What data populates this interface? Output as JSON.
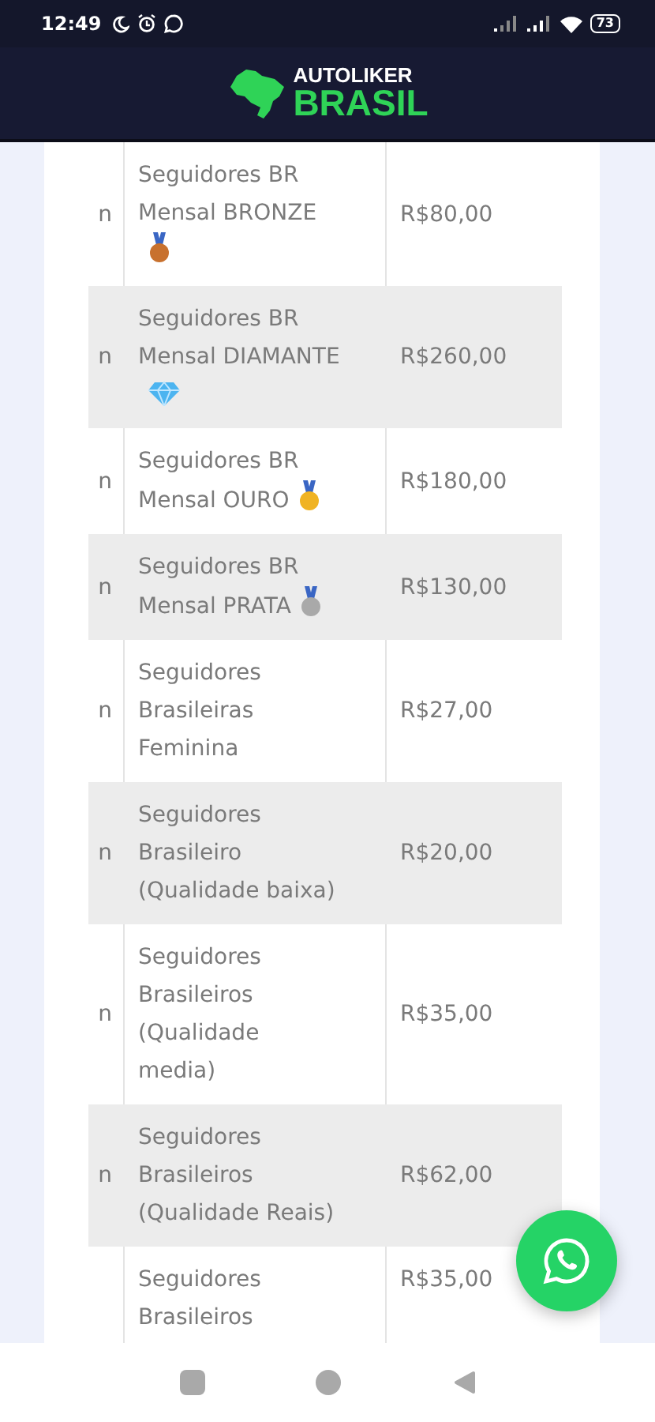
{
  "status_bar": {
    "time": "12:49",
    "battery": "73"
  },
  "header": {
    "logo_top": "AUTOLIKER",
    "logo_bottom": "BRASIL"
  },
  "table": {
    "rows": [
      {
        "column_1": "n",
        "name": "Seguidores BR Mensal BRONZE",
        "kind": "medal",
        "color": "#c8712e",
        "price": "R$80,00"
      },
      {
        "column_1": "n",
        "name": "Seguidores BR Mensal DIAMANTE",
        "kind": "diamond",
        "price": "R$260,00"
      },
      {
        "column_1": "n",
        "name": "Seguidores BR Mensal OURO",
        "kind": "medal",
        "color": "#f0b323",
        "price": "R$180,00"
      },
      {
        "column_1": "n",
        "name": "Seguidores BR Mensal PRATA",
        "kind": "medal",
        "color": "#a9a9a9",
        "price": "R$130,00"
      },
      {
        "column_1": "n",
        "name": "Seguidores Brasileiras Feminina",
        "price": "R$27,00"
      },
      {
        "column_1": "n",
        "name": "Seguidores Brasileiro (Qualidade baixa)",
        "price": "R$20,00"
      },
      {
        "column_1": "n",
        "name": "Seguidores Brasileiros (Qualidade media)",
        "price": "R$35,00"
      },
      {
        "column_1": "n",
        "name": "Seguidores Brasileiros (Qualidade Reais)",
        "price": "R$62,00"
      },
      {
        "name": "Seguidores Brasileiros",
        "price": "R$35,00"
      }
    ]
  }
}
